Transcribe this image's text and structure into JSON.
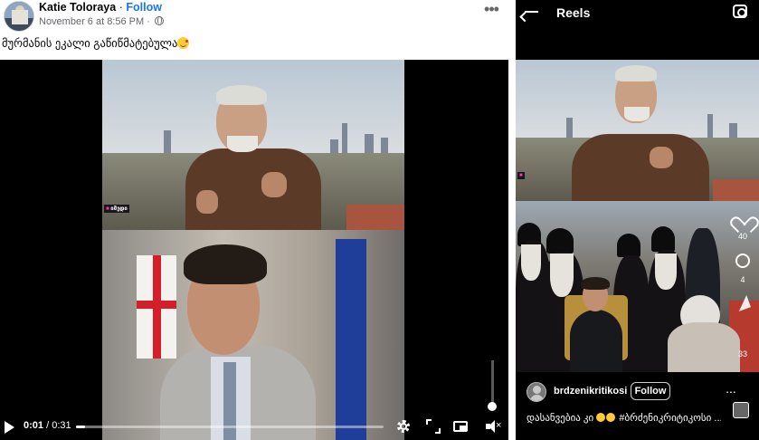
{
  "facebook_post": {
    "author_name": "Katie Toloraya",
    "separator": "·",
    "follow_label": "Follow",
    "timestamp": "November 6 at 8:56 PM",
    "privacy_icon": "globe-icon",
    "more_icon": "more-horizontal-icon",
    "more_label": "•••",
    "caption": "მურმანის ეკალი გაწიწმატებულა",
    "caption_emoji": "face-blowing-kiss-emoji",
    "video": {
      "current_time": "0:01",
      "time_separator": "/",
      "duration": "0:31",
      "progress": 0.03,
      "volume_level": 1.0,
      "controls": [
        "play-icon",
        "settings-gear-icon",
        "fullscreen-expand-icon",
        "picture-in-picture-icon",
        "muted-speaker-icon"
      ]
    }
  },
  "instagram_reels": {
    "title": "Reels",
    "back_icon": "arrow-left-icon",
    "camera_icon": "camera-icon",
    "likes_count": "40",
    "comments_count": "4",
    "shares_count": "33",
    "username": "brdzenikritikosi",
    "follow_label": "Follow",
    "caption_prefix": "დასანვებია კი",
    "caption_suffix": "#ბრძენიკრიტიკოსი ...",
    "more_label": "...",
    "tv_logo_text": "იმედი"
  },
  "colors": {
    "fb_link_blue": "#1877f2",
    "fb_text": "#050505",
    "fb_secondary": "#65676b",
    "ig_background": "#000000"
  }
}
